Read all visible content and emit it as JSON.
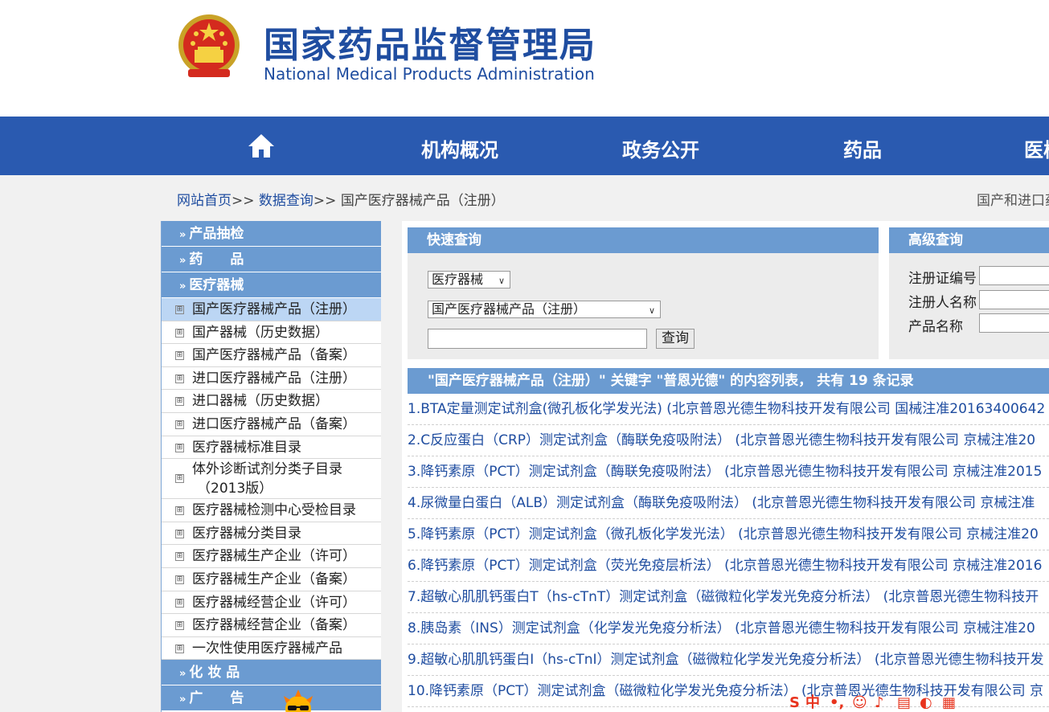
{
  "header": {
    "title_cn": "国家药品监督管理局",
    "title_en": "National Medical Products Administration",
    "emblem_icon": "national-emblem-icon"
  },
  "nav": {
    "home_icon": "home-icon",
    "items": [
      {
        "label": "机构概况"
      },
      {
        "label": "政务公开"
      },
      {
        "label": "药品"
      },
      {
        "label": "医械"
      }
    ]
  },
  "breadcrumb": {
    "home": "网站首页",
    "sep": ">>",
    "query": "数据查询",
    "current": "国产医疗器械产品（注册）",
    "right_text": "国产和进口药"
  },
  "sidebar": {
    "sections": [
      {
        "label": "产品抽检"
      },
      {
        "label": "药　　品"
      },
      {
        "label": "医疗器械"
      }
    ],
    "items": [
      {
        "label": "国产医疗器械产品（注册）",
        "active": true
      },
      {
        "label": "国产器械（历史数据）"
      },
      {
        "label": "国产医疗器械产品（备案）"
      },
      {
        "label": "进口医疗器械产品（注册）"
      },
      {
        "label": "进口器械（历史数据）"
      },
      {
        "label": "进口医疗器械产品（备案）"
      },
      {
        "label": "医疗器械标准目录"
      },
      {
        "label": "体外诊断试剂分类子目录",
        "label2": "（2013版）"
      },
      {
        "label": "医疗器械检测中心受检目录"
      },
      {
        "label": "医疗器械分类目录"
      },
      {
        "label": "医疗器械生产企业（许可）"
      },
      {
        "label": "医疗器械生产企业（备案）"
      },
      {
        "label": "医疗器械经营企业（许可）"
      },
      {
        "label": "医疗器械经营企业（备案）"
      },
      {
        "label": "一次性使用医疗器械产品"
      }
    ],
    "bottom_sections": [
      {
        "label": "化 妆 品"
      },
      {
        "label": "广　　告"
      }
    ],
    "box_glyph": "⊞",
    "raquo": "»"
  },
  "quick_search": {
    "title": "快速查询",
    "category_value": "医疗器械",
    "database_value": "国产医疗器械产品（注册）",
    "keyword_value": "",
    "button_label": "查询"
  },
  "advanced_search": {
    "title": "高级查询",
    "fields": [
      {
        "label": "注册证编号"
      },
      {
        "label": "注册人名称"
      },
      {
        "label": "产品名称"
      }
    ]
  },
  "results": {
    "header": "\"国产医疗器械产品（注册）\" 关键字 \"普恩光德\" 的内容列表， 共有 19 条记录",
    "items": [
      "1.BTA定量测定试剂盒(微孔板化学发光法) (北京普恩光德生物科技开发有限公司 国械注准20163400642",
      "2.C反应蛋白（CRP）测定试剂盒（酶联免疫吸附法） (北京普恩光德生物科技开发有限公司 京械注准20",
      "3.降钙素原（PCT）测定试剂盒（酶联免疫吸附法） (北京普恩光德生物科技开发有限公司 京械注准2015",
      "4.尿微量白蛋白（ALB）测定试剂盒（酶联免疫吸附法） (北京普恩光德生物科技开发有限公司 京械注准",
      "5.降钙素原（PCT）测定试剂盒（微孔板化学发光法） (北京普恩光德生物科技开发有限公司 京械注准20",
      "6.降钙素原（PCT）测定试剂盒（荧光免疫层析法） (北京普恩光德生物科技开发有限公司 京械注准2016",
      "7.超敏心肌肌钙蛋白T（hs-cTnT）测定试剂盒（磁微粒化学发光免疫分析法） (北京普恩光德生物科技开",
      "8.胰岛素（INS）测定试剂盒（化学发光免疫分析法） (北京普恩光德生物科技开发有限公司 京械注准20",
      "9.超敏心肌肌钙蛋白I（hs-cTnI）测定试剂盒（磁微粒化学发光免疫分析法） (北京普恩光德生物科技开发",
      "10.降钙素原（PCT）测定试剂盒（磁微粒化学发光免疫分析法） (北京普恩光德生物科技开发有限公司 京"
    ]
  },
  "ime_toolbar": {
    "logo": "S",
    "mode": "中",
    "icons": [
      "punctuation-icon",
      "emoji-icon",
      "voice-icon",
      "keyboard-icon",
      "skin-icon",
      "user-icon",
      "toolbox-icon"
    ]
  },
  "colors": {
    "brand_blue": "#1f4da0",
    "nav_blue": "#2a5ab0",
    "panel_blue": "#6b9bd1",
    "active_item": "#bcd6f4"
  }
}
